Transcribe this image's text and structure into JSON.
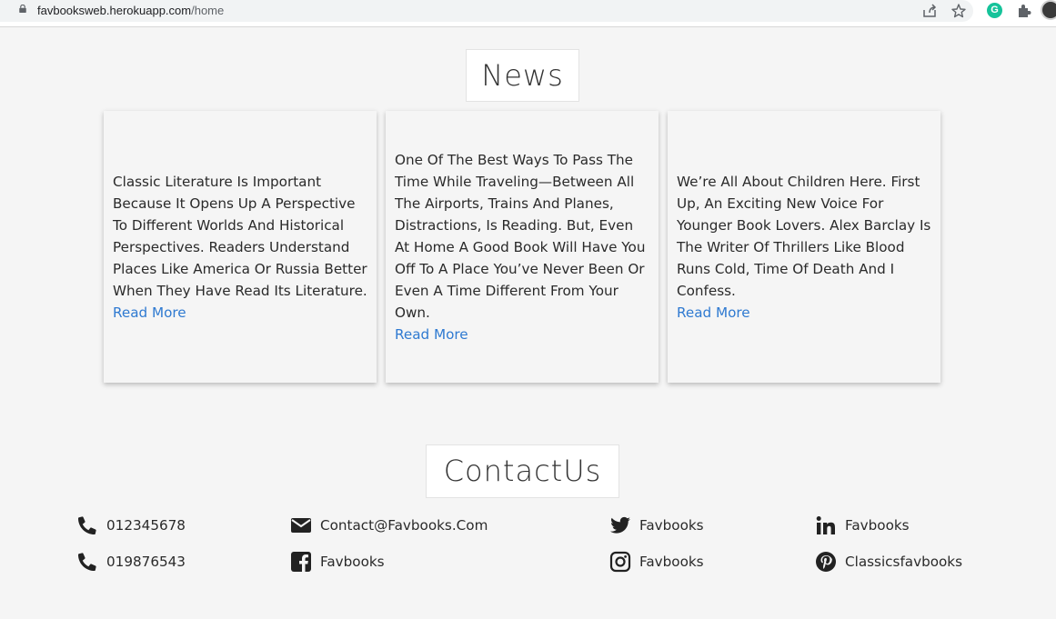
{
  "browser": {
    "url_host": "favbooksweb.herokuapp.com",
    "url_path": "/home",
    "extension_letter": "G"
  },
  "news": {
    "title": "News",
    "cards": [
      {
        "text": "Classic Literature Is Important Because It Opens Up A Perspective To Different Worlds And Historical Perspectives. Readers Understand Places Like America Or Russia Better When They Have Read Its Literature.",
        "link": "Read More"
      },
      {
        "text": "One Of The Best Ways To Pass The Time While Traveling—Between All The Airports, Trains And Planes, Distractions, Is Reading. But, Even At Home A Good Book Will Have You Off To A Place You’ve Never Been Or Even A Time Different From Your Own.",
        "link": "Read More"
      },
      {
        "text": "We’re All About Children Here. First Up, An Exciting New Voice For Younger Book Lovers. Alex Barclay Is The Writer Of Thrillers Like Blood Runs Cold, Time Of Death And I Confess.",
        "link": "Read More"
      }
    ]
  },
  "contact": {
    "title": "ContactUs",
    "items": [
      {
        "icon": "phone-icon",
        "text": "012345678"
      },
      {
        "icon": "phone-icon",
        "text": "019876543"
      },
      {
        "icon": "envelope-icon",
        "text": "Contact@Favbooks.Com"
      },
      {
        "icon": "facebook-icon",
        "text": "Favbooks"
      },
      {
        "icon": "twitter-icon",
        "text": "Favbooks"
      },
      {
        "icon": "instagram-icon",
        "text": "Favbooks"
      },
      {
        "icon": "linkedin-icon",
        "text": "Favbooks"
      },
      {
        "icon": "pinterest-icon",
        "text": "Classicsfavbooks"
      }
    ]
  },
  "colors": {
    "background": "#f5f5f5",
    "link": "#2f7ad1",
    "text": "#2a2a2a"
  }
}
